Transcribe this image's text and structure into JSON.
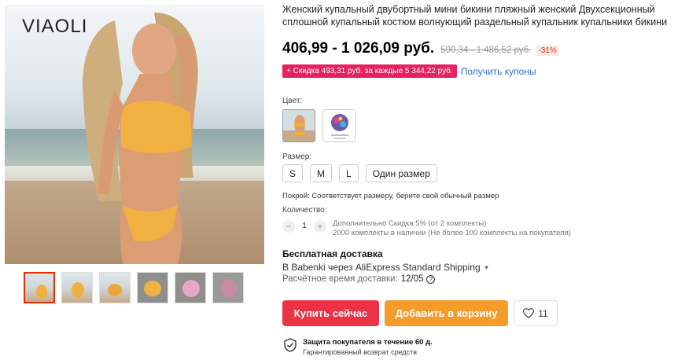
{
  "product": {
    "brand_logo": "VIAOLI",
    "title": "Женский купальный двубортный мини бикини пляжный женский Двухсекционный сплошной купальный костюм волнующий раздельный купальник купальники бикини",
    "price_range": "406,99 - 1 026,09 руб.",
    "old_price_range": "590,34 - 1 486,52 руб.",
    "discount_percent": "-31%"
  },
  "coupon": {
    "badge": "+ Скидка 493,31 руб. за каждые 5 344,22 руб.",
    "link": "Получить купоны"
  },
  "color": {
    "label": "Цвет:",
    "options": [
      "orange-bikini",
      "floral-print"
    ]
  },
  "size": {
    "label": "Размер:",
    "options": [
      "S",
      "M",
      "L",
      "Один размер"
    ]
  },
  "fit": "Покрой: Соответствует размеру, берите свой обычный размер",
  "quantity": {
    "label": "Количество:",
    "value": "1",
    "minus": "−",
    "plus": "+",
    "info_line1": "Дополнительно Скидка 5% (от 2 комплекты)",
    "info_line2": "2000 комплекты в наличии (Не более 100 комплекты на покупателя)"
  },
  "shipping": {
    "title": "Бесплатная доставка",
    "method": "В Babenki через AliExpress Standard Shipping",
    "time_label": "Расчётное время доставки:",
    "time_value": "12/05"
  },
  "actions": {
    "buy_now": "Купить сейчас",
    "add_to_cart": "Добавить в корзину",
    "wishlist_count": "11"
  },
  "protection": {
    "title": "Защита покупателя в течение 60 д.",
    "subtitle": "Гарантированный возврат средств"
  },
  "colors": {
    "price_red": "#e62e04",
    "buy_button": "#ee3245",
    "cart_button": "#f59b2a",
    "coupon_badge": "#e6215e",
    "link_blue": "#2c6ecb"
  }
}
